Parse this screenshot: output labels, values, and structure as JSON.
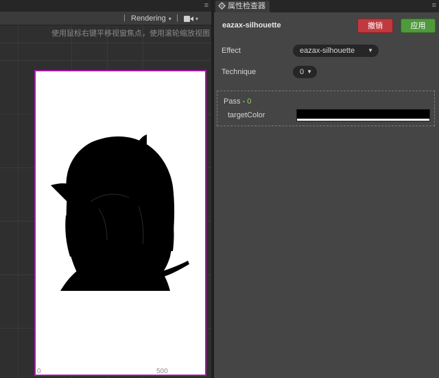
{
  "scene": {
    "toolbar": {
      "separator": "|",
      "render_mode": "Rendering",
      "caret": "▾",
      "camera_icon": "camera-icon"
    },
    "hint": "使用鼠标右键平移视窗焦点，使用滚轮缩放视图",
    "axis": {
      "x_start": "0",
      "x_mark": "500"
    },
    "frame_color": "#a31aa3"
  },
  "inspector": {
    "tab_label": "属性检查器",
    "tab_icon": "gear-icon",
    "asset_name": "eazax-silhouette",
    "revert_label": "撤销",
    "apply_label": "应用",
    "effect": {
      "label": "Effect",
      "value": "eazax-silhouette"
    },
    "technique": {
      "label": "Technique",
      "value": "0"
    },
    "pass": {
      "prefix": "Pass - ",
      "index": "0",
      "target_color_label": "targetColor",
      "target_color": "#000000"
    },
    "colors": {
      "revert": "#c0393f",
      "apply": "#4f9a3c",
      "pass_index": "#8fd06a"
    }
  },
  "menu_glyph": "≡"
}
